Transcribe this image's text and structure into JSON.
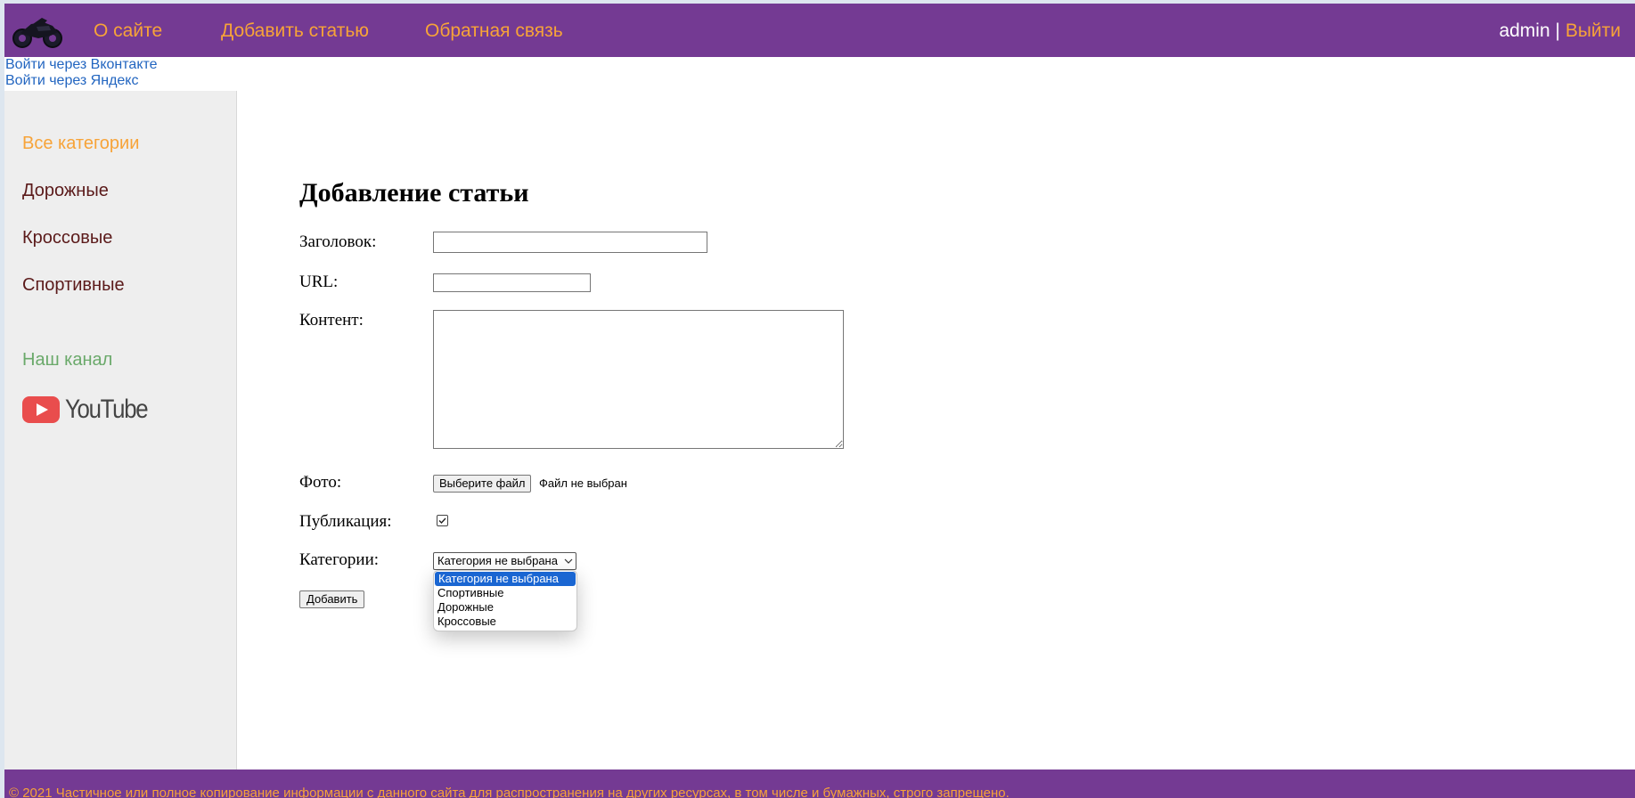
{
  "header": {
    "nav": [
      "О сайте",
      "Добавить статью",
      "Обратная связь"
    ],
    "user": "admin",
    "separator": "|",
    "logout": "Выйти"
  },
  "social_login": {
    "vk": "Войти через Вконтакте",
    "yandex": "Войти через Яндекс"
  },
  "sidebar": {
    "categories": [
      "Все категории",
      "Дорожные",
      "Кроссовые",
      "Спортивные"
    ],
    "active_index": 0,
    "channel_title": "Наш канал",
    "youtube_label": "YouTube"
  },
  "form": {
    "title": "Добавление статьи",
    "labels": {
      "heading": "Заголовок:",
      "url": "URL:",
      "content": "Контент:",
      "photo": "Фото:",
      "publish": "Публикация:",
      "category": "Категории:"
    },
    "values": {
      "heading": "",
      "url": "",
      "content": ""
    },
    "file_button": "Выберите файл",
    "file_status": "Файл не выбран",
    "publish_checked": true,
    "category_selected": "Категория не выбрана",
    "category_options": [
      "Категория не выбрана",
      "Спортивные",
      "Дорожные",
      "Кроссовые"
    ],
    "submit": "Добавить"
  },
  "footer": {
    "text": "© 2021 Частичное или полное копирование информации с данного сайта для распространения на других ресурсах, в том числе и бумажных, строго запрещено."
  },
  "colors": {
    "header_bg": "#743a93",
    "link_orange": "#f7a338",
    "sidebar_bg": "#eeeeee",
    "category_text": "#5b1a1a",
    "channel_green": "#6aa96a",
    "social_blue": "#2265c0",
    "youtube_red": "#e94d4d",
    "dropdown_selected": "#1a66d2"
  }
}
